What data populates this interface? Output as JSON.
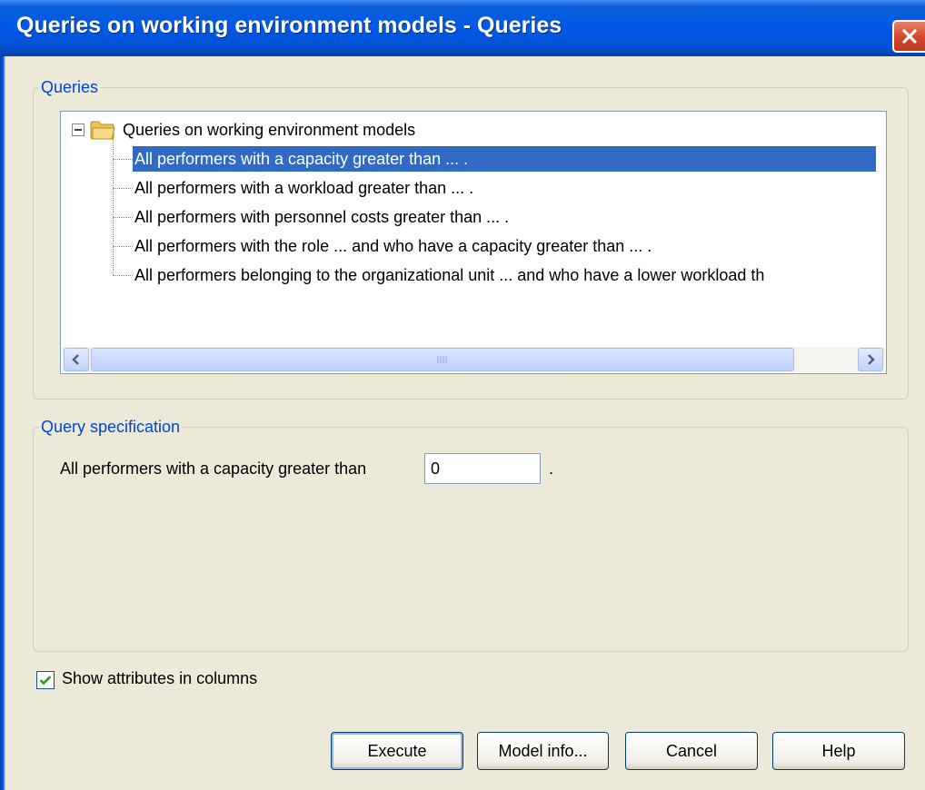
{
  "window": {
    "title": "Queries on working environment models - Queries"
  },
  "queries_group": {
    "legend": "Queries",
    "root": "Queries on working environment models",
    "items": [
      "All performers with a capacity greater than ... .",
      "All performers with a workload greater than ... .",
      "All performers with personnel costs greater than ... .",
      "All performers with the role ... and who have a capacity greater than ... .",
      "All performers belonging to the organizational unit ... and who have a lower workload th"
    ],
    "selected_index": 0
  },
  "spec_group": {
    "legend": "Query specification",
    "label": "All performers with a capacity greater than",
    "value": "0",
    "suffix": "."
  },
  "options": {
    "show_attributes_label": "Show attributes in columns",
    "show_attributes_checked": true
  },
  "buttons": {
    "execute": "Execute",
    "model_info": "Model info...",
    "cancel": "Cancel",
    "help": "Help"
  },
  "colors": {
    "accent": "#316ac5",
    "title_bar": "#0058e6",
    "legend": "#0046d5"
  }
}
